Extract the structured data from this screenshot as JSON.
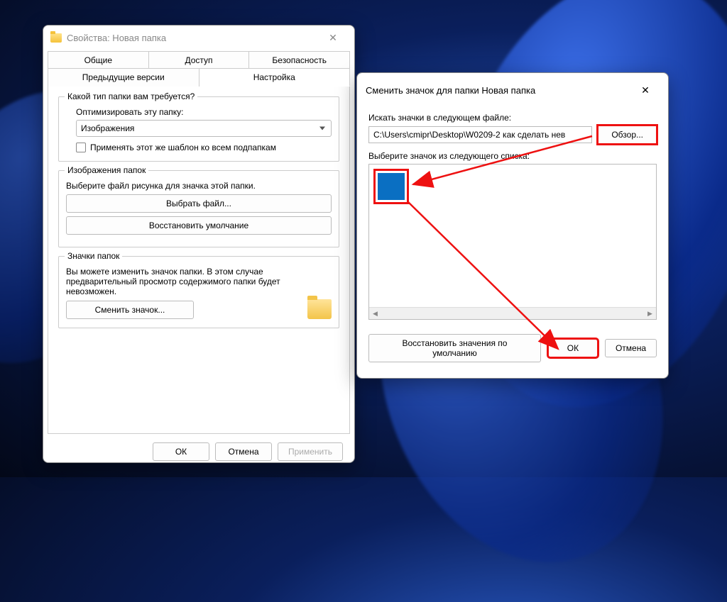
{
  "desktop": {
    "os": "Windows 11"
  },
  "properties": {
    "title": "Свойства: Новая папка",
    "tabs": {
      "general": "Общие",
      "sharing": "Доступ",
      "security": "Безопасность",
      "previous": "Предыдущие версии",
      "customize": "Настройка"
    },
    "type_group": {
      "legend": "Какой тип папки вам требуется?",
      "optimize": "Оптимизировать эту папку:",
      "selected": "Изображения",
      "apply_sub": "Применять этот же шаблон ко всем подпапкам"
    },
    "image_group": {
      "legend": "Изображения папок",
      "desc": "Выберите файл рисунка для значка этой папки.",
      "choose": "Выбрать файл...",
      "restore": "Восстановить умолчание"
    },
    "icon_group": {
      "legend": "Значки папок",
      "desc": "Вы можете изменить значок папки. В этом случае предварительный просмотр содержимого папки будет невозможен.",
      "change": "Сменить значок..."
    },
    "footer": {
      "ok": "ОК",
      "cancel": "Отмена",
      "apply": "Применить"
    }
  },
  "changeIcon": {
    "title": "Сменить значок для папки Новая папка",
    "look_label": "Искать значки в следующем файле:",
    "path": "C:\\Users\\cmipr\\Desktop\\W0209-2 как сделать нев",
    "browse": "Обзор...",
    "list_label": "Выберите значок из следующего списка:",
    "restore": "Восстановить значения по умолчанию",
    "ok": "ОК",
    "cancel": "Отмена"
  }
}
